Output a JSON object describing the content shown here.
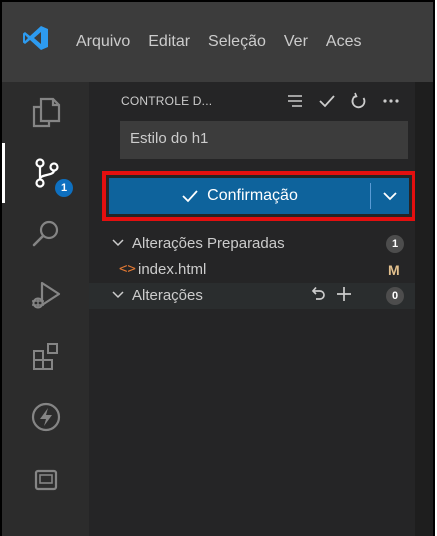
{
  "menu": {
    "items": [
      "Arquivo",
      "Editar",
      "Seleção",
      "Ver",
      "Aces"
    ]
  },
  "activity": {
    "scm_badge": "1"
  },
  "scm": {
    "title": "CONTROLE D...",
    "commit_message": "Estilo do h1",
    "commit_button": "Confirmação",
    "staged_section": "Alterações Preparadas",
    "staged_count": "1",
    "staged_file": "index.html",
    "staged_file_status": "M",
    "changes_section": "Alterações",
    "changes_count": "0"
  },
  "colors": {
    "accent": "#0e639c",
    "highlight_border": "#e40f0f",
    "badge": "#0e70c0"
  }
}
